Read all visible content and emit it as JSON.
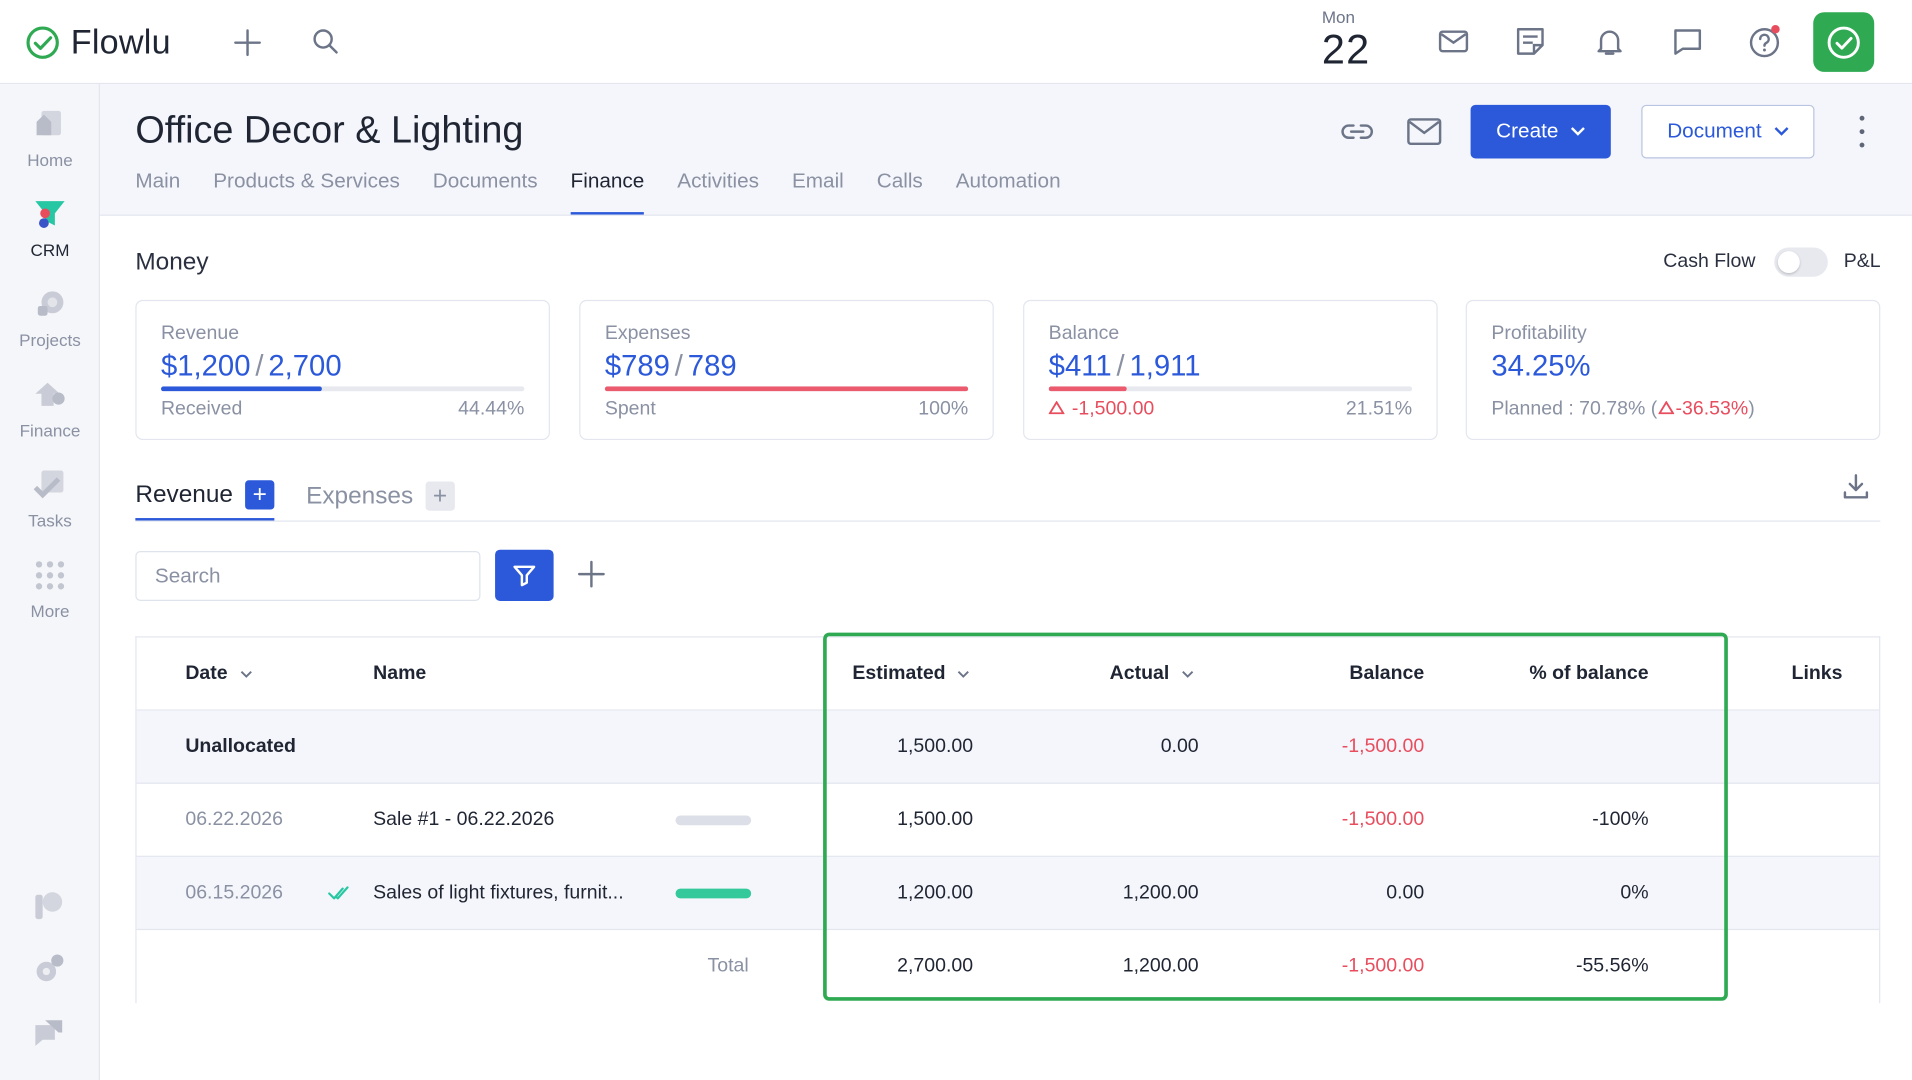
{
  "app": {
    "name": "Flowlu",
    "date_dow": "Mon",
    "date_day": "22",
    "brand_green": "#2faa53",
    "accent": "#2b59d9"
  },
  "sidebar": {
    "items": [
      {
        "label": "Home"
      },
      {
        "label": "CRM"
      },
      {
        "label": "Projects"
      },
      {
        "label": "Finance"
      },
      {
        "label": "Tasks"
      },
      {
        "label": "More"
      }
    ]
  },
  "header": {
    "title": "Office Decor & Lighting",
    "create_label": "Create",
    "document_label": "Document",
    "tabs": [
      {
        "label": "Main"
      },
      {
        "label": "Products & Services"
      },
      {
        "label": "Documents"
      },
      {
        "label": "Finance"
      },
      {
        "label": "Activities"
      },
      {
        "label": "Email"
      },
      {
        "label": "Calls"
      },
      {
        "label": "Automation"
      }
    ]
  },
  "money": {
    "title": "Money",
    "toggle_left": "Cash Flow",
    "toggle_right": "P&L",
    "cash_flow_on": false,
    "revenue": {
      "label": "Revenue",
      "value": "$1,200",
      "total": "2,700",
      "sub": "Received",
      "pct": "44.44%",
      "progress": 0.4444
    },
    "expenses": {
      "label": "Expenses",
      "value": "$789",
      "total": "789",
      "sub": "Spent",
      "pct": "100%",
      "progress": 1.0
    },
    "balance": {
      "label": "Balance",
      "value": "$411",
      "total": "1,911",
      "sub": "-1,500.00",
      "pct": "21.51%",
      "progress": 0.2151
    },
    "profitability": {
      "label": "Profitability",
      "value": "34.25%",
      "planned": "Planned : 70.78% (",
      "delta": "-36.53%",
      "close": ")"
    }
  },
  "subtabs": {
    "revenue": "Revenue",
    "expenses": "Expenses"
  },
  "search": {
    "placeholder": "Search"
  },
  "table": {
    "headers": {
      "date": "Date",
      "name": "Name",
      "estimated": "Estimated",
      "actual": "Actual",
      "balance": "Balance",
      "pct": "% of balance",
      "links": "Links"
    },
    "rows": [
      {
        "date": "Unallocated",
        "name": "",
        "estimated": "1,500.00",
        "actual": "0.00",
        "balance": "-1,500.00",
        "pct": ""
      },
      {
        "date": "06.22.2026",
        "name": "Sale #1 - 06.22.2026",
        "estimated": "1,500.00",
        "actual": "",
        "balance": "-1,500.00",
        "pct": "-100%",
        "bar_color": "#dcdfe7"
      },
      {
        "date": "06.15.2026",
        "name": "Sales of light fixtures, furnit...",
        "estimated": "1,200.00",
        "actual": "1,200.00",
        "balance": "0.00",
        "pct": "0%",
        "bar_color": "#34c99a"
      }
    ],
    "total": {
      "label": "Total",
      "estimated": "2,700.00",
      "actual": "1,200.00",
      "balance": "-1,500.00",
      "pct": "-55.56%"
    }
  }
}
